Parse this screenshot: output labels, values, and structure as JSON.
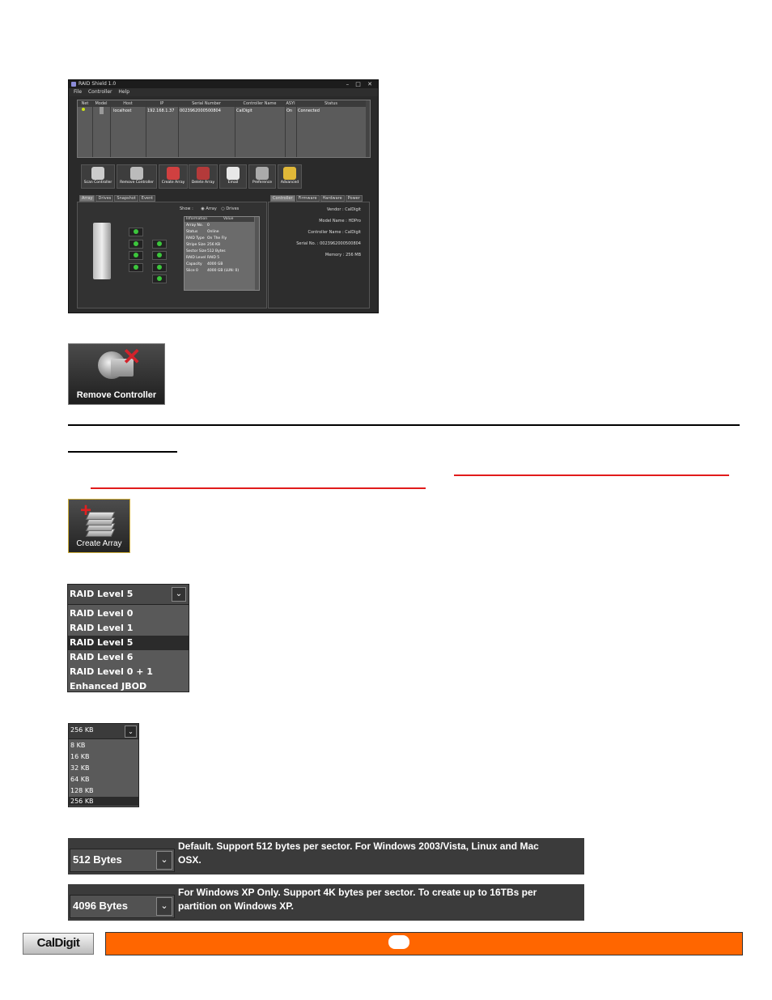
{
  "window": {
    "title": "RAID Shield 1.0",
    "menu": [
      "File",
      "Controller",
      "Help"
    ],
    "columns": [
      "Net",
      "Model",
      "Host",
      "IP",
      "Serial Number",
      "Controller Name",
      "ASYI",
      "Status"
    ],
    "row": {
      "host": "localhost",
      "ip": "192.168.1.37",
      "serial": "0023962000500804",
      "controller": "CalDigit",
      "asyi": "On",
      "status": "Connected"
    },
    "toolbar": [
      "Scan Controller",
      "Remove Controller",
      "Create Array",
      "Delete Array",
      "Email",
      "Preference",
      "Advanced"
    ],
    "left_tabs": [
      "Array",
      "Drives",
      "Snapshot",
      "Event"
    ],
    "right_tabs": [
      "Controller",
      "Firmware",
      "Hardware",
      "Power"
    ],
    "show_label": "Show :",
    "show_options": [
      "Array",
      "Drives"
    ],
    "info_headers": [
      "Information",
      "Value"
    ],
    "info_rows": [
      {
        "k": "Array No.",
        "v": "0"
      },
      {
        "k": "Status",
        "v": "Online"
      },
      {
        "k": "RAID Type",
        "v": "On The Fly"
      },
      {
        "k": "Stripe Size",
        "v": "256 KB"
      },
      {
        "k": "Sector Size",
        "v": "512 Bytes"
      },
      {
        "k": "RAID Level",
        "v": "RAID 5"
      },
      {
        "k": "Capacity",
        "v": "4000 GB"
      },
      {
        "k": "Slice 0",
        "v": "4000 GB (LUN: 0)"
      }
    ],
    "controller_info": [
      "Vendor : CalDigit",
      "Model Name : HDPro",
      "Controller Name : CalDigit",
      "Serial No. : 0023962000500804",
      "Memory : 256 MB"
    ]
  },
  "remove_button": {
    "label": "Remove Controller"
  },
  "create_button": {
    "label": "Create Array"
  },
  "raid_dropdown": {
    "selected": "RAID Level 5",
    "options": [
      "RAID Level 0",
      "RAID Level 1",
      "RAID Level 5",
      "RAID Level 6",
      "RAID Level 0 + 1",
      "Enhanced JBOD"
    ],
    "highlighted_index": 2
  },
  "stripe_dropdown": {
    "selected": "256 KB",
    "options": [
      "8 KB",
      "16 KB",
      "32 KB",
      "64 KB",
      "128 KB",
      "256 KB"
    ],
    "highlighted_index": 5
  },
  "sector_512": {
    "value": "512 Bytes",
    "line1": "Default. Support 512 bytes per sector. For Windows 2003/Vista, Linux and Mac",
    "line2": "OSX."
  },
  "sector_4096": {
    "value": "4096 Bytes",
    "line1": "For Windows XP Only. Support 4K bytes per sector. To create up to 16TBs per",
    "line2": "partition on Windows XP."
  },
  "footer": {
    "logo": "CalDigit"
  },
  "colors": {
    "accent": "#ff6600",
    "underline_red": "#e11b1b"
  },
  "icons": {
    "dropdown": "chevron-down-icon"
  }
}
